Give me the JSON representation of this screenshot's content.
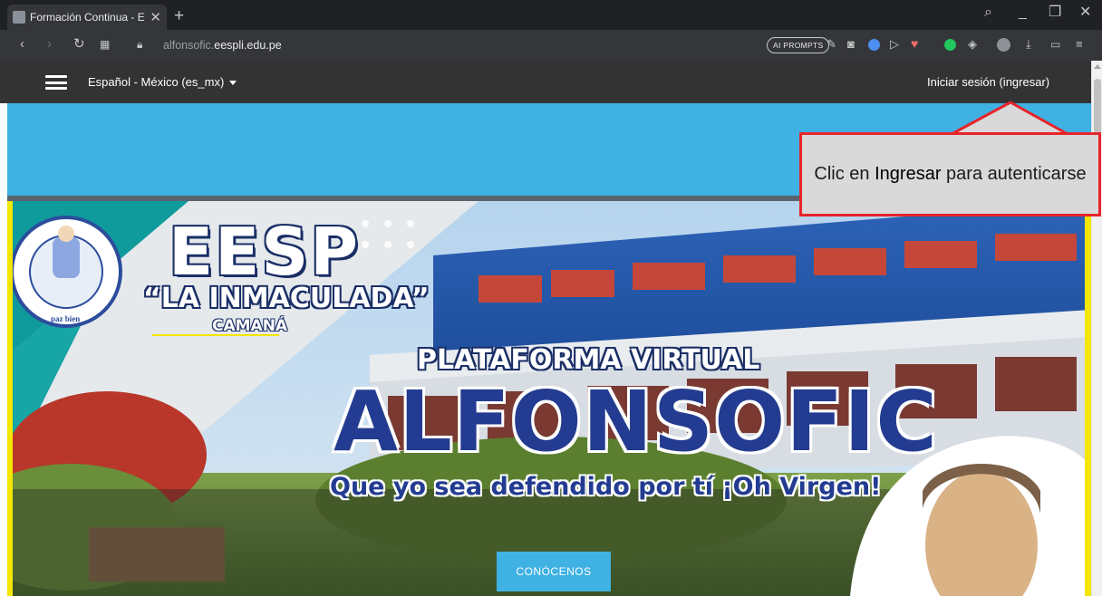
{
  "browser": {
    "tab_title": "Formación Continua - EESP",
    "tab_close": "✕",
    "new_tab": "+",
    "url_prefix": "alfonsofic.",
    "url_domain": "eespli.edu.pe",
    "ai_prompts": "AI PROMPTS",
    "window_controls": [
      "⌕",
      "_",
      "❐",
      "✕"
    ]
  },
  "navbar": {
    "language": "Español - México (es_mx)",
    "login": "Iniciar sesión (ingresar)"
  },
  "hero": {
    "school_name": "EESP",
    "school_subtitle": "“LA INMACULADA”",
    "school_city": "CAMANÁ",
    "platform_label": "PLATAFORMA VIRTUAL",
    "platform_name": "ALFONSOFIC",
    "motto": "Que yo sea defendido por tí ¡Oh Virgen!",
    "cta": "CONÓCENOS",
    "seal_text": "paz bien"
  },
  "callout": {
    "before": "Clic en ",
    "emph": "Ingresar",
    "after": " para autenticarse"
  },
  "colors": {
    "band": "#3fb1e3",
    "navbar": "#333333",
    "accent_border": "#f3e600",
    "callout_border": "#e8242a",
    "cta_bg": "#3fb1e3",
    "title_blue": "#233c91"
  }
}
